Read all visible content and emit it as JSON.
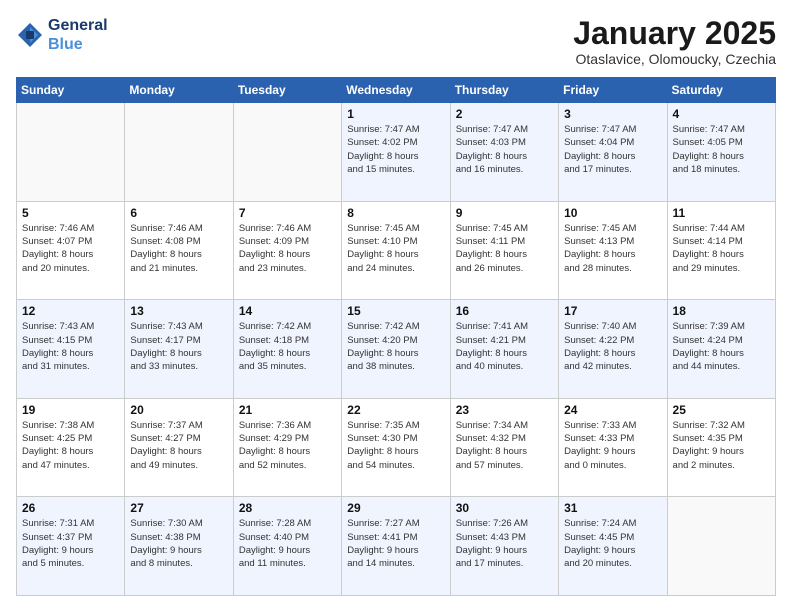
{
  "logo": {
    "line1": "General",
    "line2": "Blue"
  },
  "header": {
    "month": "January 2025",
    "location": "Otaslavice, Olomoucky, Czechia"
  },
  "weekdays": [
    "Sunday",
    "Monday",
    "Tuesday",
    "Wednesday",
    "Thursday",
    "Friday",
    "Saturday"
  ],
  "weeks": [
    [
      {
        "day": "",
        "info": ""
      },
      {
        "day": "",
        "info": ""
      },
      {
        "day": "",
        "info": ""
      },
      {
        "day": "1",
        "info": "Sunrise: 7:47 AM\nSunset: 4:02 PM\nDaylight: 8 hours\nand 15 minutes."
      },
      {
        "day": "2",
        "info": "Sunrise: 7:47 AM\nSunset: 4:03 PM\nDaylight: 8 hours\nand 16 minutes."
      },
      {
        "day": "3",
        "info": "Sunrise: 7:47 AM\nSunset: 4:04 PM\nDaylight: 8 hours\nand 17 minutes."
      },
      {
        "day": "4",
        "info": "Sunrise: 7:47 AM\nSunset: 4:05 PM\nDaylight: 8 hours\nand 18 minutes."
      }
    ],
    [
      {
        "day": "5",
        "info": "Sunrise: 7:46 AM\nSunset: 4:07 PM\nDaylight: 8 hours\nand 20 minutes."
      },
      {
        "day": "6",
        "info": "Sunrise: 7:46 AM\nSunset: 4:08 PM\nDaylight: 8 hours\nand 21 minutes."
      },
      {
        "day": "7",
        "info": "Sunrise: 7:46 AM\nSunset: 4:09 PM\nDaylight: 8 hours\nand 23 minutes."
      },
      {
        "day": "8",
        "info": "Sunrise: 7:45 AM\nSunset: 4:10 PM\nDaylight: 8 hours\nand 24 minutes."
      },
      {
        "day": "9",
        "info": "Sunrise: 7:45 AM\nSunset: 4:11 PM\nDaylight: 8 hours\nand 26 minutes."
      },
      {
        "day": "10",
        "info": "Sunrise: 7:45 AM\nSunset: 4:13 PM\nDaylight: 8 hours\nand 28 minutes."
      },
      {
        "day": "11",
        "info": "Sunrise: 7:44 AM\nSunset: 4:14 PM\nDaylight: 8 hours\nand 29 minutes."
      }
    ],
    [
      {
        "day": "12",
        "info": "Sunrise: 7:43 AM\nSunset: 4:15 PM\nDaylight: 8 hours\nand 31 minutes."
      },
      {
        "day": "13",
        "info": "Sunrise: 7:43 AM\nSunset: 4:17 PM\nDaylight: 8 hours\nand 33 minutes."
      },
      {
        "day": "14",
        "info": "Sunrise: 7:42 AM\nSunset: 4:18 PM\nDaylight: 8 hours\nand 35 minutes."
      },
      {
        "day": "15",
        "info": "Sunrise: 7:42 AM\nSunset: 4:20 PM\nDaylight: 8 hours\nand 38 minutes."
      },
      {
        "day": "16",
        "info": "Sunrise: 7:41 AM\nSunset: 4:21 PM\nDaylight: 8 hours\nand 40 minutes."
      },
      {
        "day": "17",
        "info": "Sunrise: 7:40 AM\nSunset: 4:22 PM\nDaylight: 8 hours\nand 42 minutes."
      },
      {
        "day": "18",
        "info": "Sunrise: 7:39 AM\nSunset: 4:24 PM\nDaylight: 8 hours\nand 44 minutes."
      }
    ],
    [
      {
        "day": "19",
        "info": "Sunrise: 7:38 AM\nSunset: 4:25 PM\nDaylight: 8 hours\nand 47 minutes."
      },
      {
        "day": "20",
        "info": "Sunrise: 7:37 AM\nSunset: 4:27 PM\nDaylight: 8 hours\nand 49 minutes."
      },
      {
        "day": "21",
        "info": "Sunrise: 7:36 AM\nSunset: 4:29 PM\nDaylight: 8 hours\nand 52 minutes."
      },
      {
        "day": "22",
        "info": "Sunrise: 7:35 AM\nSunset: 4:30 PM\nDaylight: 8 hours\nand 54 minutes."
      },
      {
        "day": "23",
        "info": "Sunrise: 7:34 AM\nSunset: 4:32 PM\nDaylight: 8 hours\nand 57 minutes."
      },
      {
        "day": "24",
        "info": "Sunrise: 7:33 AM\nSunset: 4:33 PM\nDaylight: 9 hours\nand 0 minutes."
      },
      {
        "day": "25",
        "info": "Sunrise: 7:32 AM\nSunset: 4:35 PM\nDaylight: 9 hours\nand 2 minutes."
      }
    ],
    [
      {
        "day": "26",
        "info": "Sunrise: 7:31 AM\nSunset: 4:37 PM\nDaylight: 9 hours\nand 5 minutes."
      },
      {
        "day": "27",
        "info": "Sunrise: 7:30 AM\nSunset: 4:38 PM\nDaylight: 9 hours\nand 8 minutes."
      },
      {
        "day": "28",
        "info": "Sunrise: 7:28 AM\nSunset: 4:40 PM\nDaylight: 9 hours\nand 11 minutes."
      },
      {
        "day": "29",
        "info": "Sunrise: 7:27 AM\nSunset: 4:41 PM\nDaylight: 9 hours\nand 14 minutes."
      },
      {
        "day": "30",
        "info": "Sunrise: 7:26 AM\nSunset: 4:43 PM\nDaylight: 9 hours\nand 17 minutes."
      },
      {
        "day": "31",
        "info": "Sunrise: 7:24 AM\nSunset: 4:45 PM\nDaylight: 9 hours\nand 20 minutes."
      },
      {
        "day": "",
        "info": ""
      }
    ]
  ]
}
